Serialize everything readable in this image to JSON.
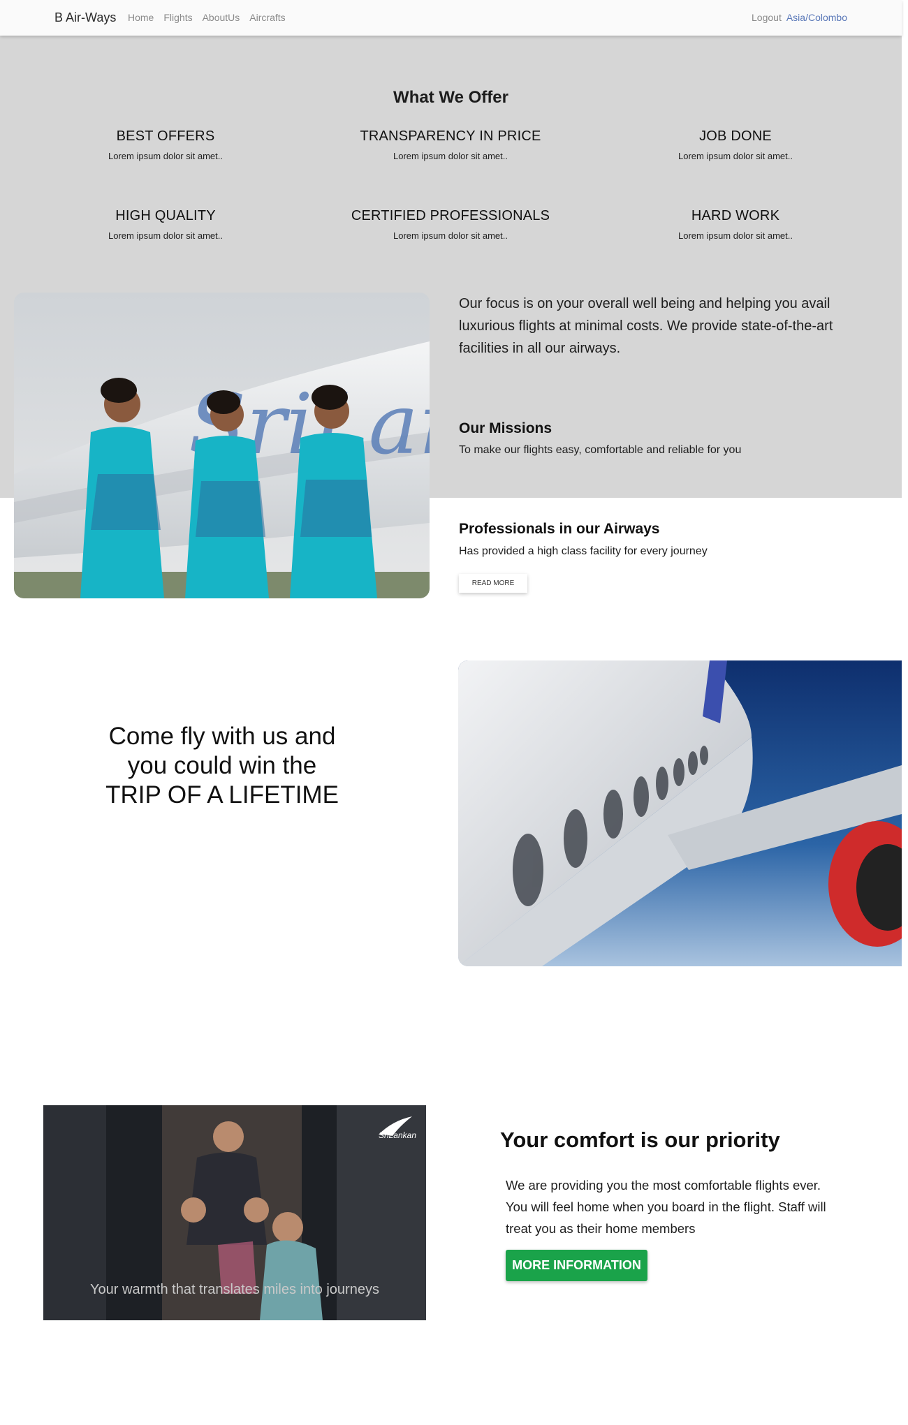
{
  "nav": {
    "brand": "B Air-Ways",
    "links": [
      "Home",
      "Flights",
      "AboutUs",
      "Aircrafts"
    ],
    "logout": "Logout",
    "timezone": "Asia/Colombo"
  },
  "offer": {
    "title": "What We Offer",
    "items": [
      {
        "title": "BEST OFFERS",
        "text": "Lorem ipsum dolor sit amet.."
      },
      {
        "title": "TRANSPARENCY IN PRICE",
        "text": "Lorem ipsum dolor sit amet.."
      },
      {
        "title": "JOB DONE",
        "text": "Lorem ipsum dolor sit amet.."
      },
      {
        "title": "HIGH QUALITY",
        "text": "Lorem ipsum dolor sit amet.."
      },
      {
        "title": "CERTIFIED PROFESSIONALS",
        "text": "Lorem ipsum dolor sit amet.."
      },
      {
        "title": "HARD WORK",
        "text": "Lorem ipsum dolor sit amet.."
      }
    ]
  },
  "about": {
    "focus": "Our focus is on your overall well being and helping you avail luxurious flights at minimal costs. We provide state-of-the-art facilities in all our airways.",
    "missions_title": "Our Missions",
    "missions_text": "To make our flights easy, comfortable and reliable for you",
    "prof_title": "Professionals in our Airways",
    "prof_text": "Has provided a high class facility for every journey",
    "read_more": "READ MORE",
    "image_text": "SriLanka"
  },
  "trip": {
    "line1": "Come fly with us and",
    "line2": "you could win the",
    "line3": "TRIP OF A LIFETIME"
  },
  "comfort": {
    "title": "Your comfort is our priority",
    "text": "We are providing you the most comfortable flights ever. You will feel home when you board in the flight. Staff will treat you as their home members",
    "button": "MORE INFORMATION",
    "video_caption": "Your warmth that translates miles into journeys",
    "video_logo": "SriLankan"
  },
  "colors": {
    "grey_band": "#d6d6d6",
    "accent_button": "#1aa34a",
    "timezone_link": "#5a78b8"
  }
}
